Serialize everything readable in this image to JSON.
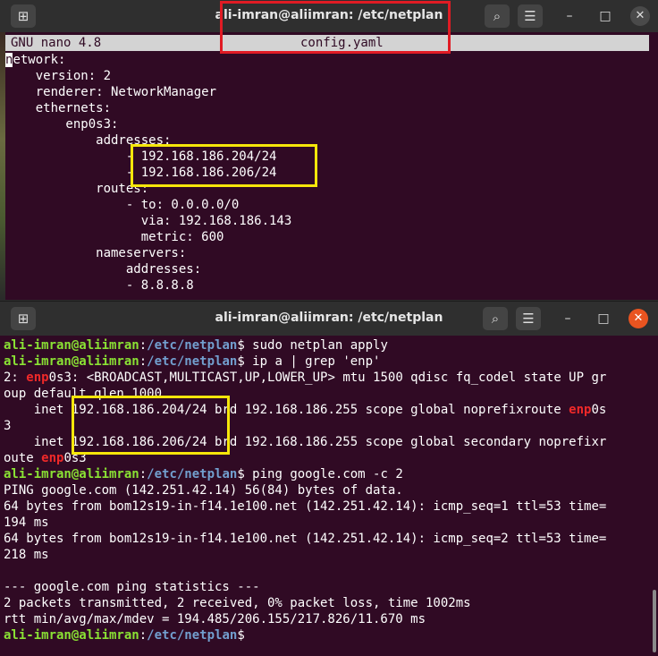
{
  "window_top": {
    "title": "ali-imran@aliimran: /etc/netplan",
    "new_tab_icon": "⊞",
    "search_icon": "⌕",
    "menu_icon": "☰",
    "minimize_icon": "–",
    "maximize_icon": "□",
    "close_icon": "✕",
    "nano_version": "GNU nano 4.8",
    "file_name": "config.yaml",
    "yaml_first_char": "n",
    "yaml_lines": [
      "etwork:",
      "    version: 2",
      "    renderer: NetworkManager",
      "    ethernets:",
      "        enp0s3:",
      "            addresses:",
      "                - 192.168.186.204/24",
      "                - 192.168.186.206/24",
      "            routes:",
      "                - to: 0.0.0.0/0",
      "                  via: 192.168.186.143",
      "                  metric: 600",
      "            nameservers:",
      "                addresses:",
      "                - 8.8.8.8"
    ]
  },
  "window_bottom": {
    "title": "ali-imran@aliimran: /etc/netplan",
    "prompt_user": "ali-imran@aliimran",
    "prompt_colon": ":",
    "prompt_path": "/etc/netplan",
    "prompt_dollar": "$",
    "cmd1": " sudo netplan apply",
    "cmd2": " ip a | grep 'enp'",
    "out_iface_num": "2: ",
    "out_iface_red": "enp",
    "out_iface_rest": "0s3: <BROADCAST,MULTICAST,UP,LOWER_UP> mtu 1500 qdisc fq_codel state UP gr",
    "out_iface_line2": "oup default qlen 1000",
    "inet1_pre": "    inet ",
    "inet1_addr": "192.168.186.204/24",
    "inet1_post": " brd 192.168.186.255 scope global noprefixroute ",
    "inet1_red": "enp",
    "inet1_tail": "0s",
    "inet1_line2": "3",
    "inet2_pre": "    inet ",
    "inet2_addr": "192.168.186.206/24",
    "inet2_post": " brd 192.168.186.255 scope global secondary noprefixr",
    "inet2_line2_a": "oute ",
    "inet2_line2_red": "enp",
    "inet2_line2_b": "0s3",
    "cmd3": " ping google.com -c 2",
    "ping_lines": [
      "PING google.com (142.251.42.14) 56(84) bytes of data.",
      "64 bytes from bom12s19-in-f14.1e100.net (142.251.42.14): icmp_seq=1 ttl=53 time=",
      "194 ms",
      "64 bytes from bom12s19-in-f14.1e100.net (142.251.42.14): icmp_seq=2 ttl=53 time=",
      "218 ms",
      "",
      "--- google.com ping statistics ---",
      "2 packets transmitted, 2 received, 0% packet loss, time 1002ms",
      "rtt min/avg/max/mdev = 194.485/206.155/217.826/11.670 ms"
    ]
  },
  "colors": {
    "terminal_bg": "#300a24",
    "prompt_user": "#8ae234",
    "prompt_path": "#729fcf",
    "highlight_red": "#e01b24",
    "highlight_yellow": "#f5e60a",
    "close_button": "#e95420"
  }
}
